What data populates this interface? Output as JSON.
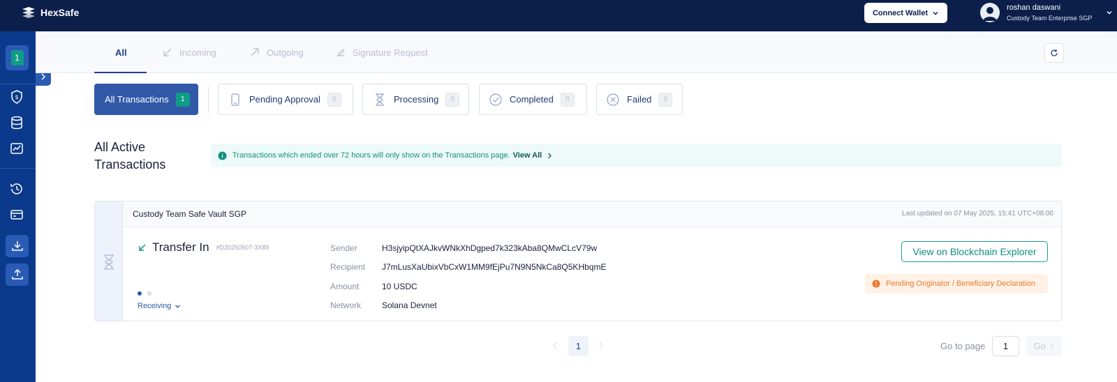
{
  "app": {
    "name": "HexSafe"
  },
  "header": {
    "connect_wallet": "Connect Wallet",
    "user_name": "roshan daswani",
    "user_org": "Custody Team Enterprise SGP"
  },
  "sidebar": {
    "badge": "1",
    "items": [
      "shield-icon",
      "database-icon",
      "chart-icon",
      "history-icon",
      "card-icon",
      "download-icon",
      "upload-icon"
    ]
  },
  "tabs": [
    {
      "label": "All",
      "icon": "",
      "active": true
    },
    {
      "label": "Incoming",
      "icon": "arrow-down-left-icon",
      "active": false
    },
    {
      "label": "Outgoing",
      "icon": "arrow-up-right-icon",
      "active": false
    },
    {
      "label": "Signature Request",
      "icon": "signature-icon",
      "active": false
    }
  ],
  "filters": [
    {
      "label": "All Transactions",
      "count": "1",
      "icon": "",
      "active": true
    },
    {
      "label": "Pending Approval",
      "count": "0",
      "icon": "phone-icon",
      "active": false
    },
    {
      "label": "Processing",
      "count": "0",
      "icon": "hourglass-icon",
      "active": false
    },
    {
      "label": "Completed",
      "count": "0",
      "icon": "check-circle-icon",
      "active": false
    },
    {
      "label": "Failed",
      "count": "0",
      "icon": "x-circle-icon",
      "active": false
    }
  ],
  "section": {
    "title": "All Active Transactions",
    "notice": "Transactions which ended over 72 hours will only show on the Transactions page.",
    "notice_link": "View All"
  },
  "transaction": {
    "vault": "Custody Team Safe Vault SGP",
    "updated": "Last updated on 07 May 2025, 15:41 UTC+08:00",
    "type": "Transfer In",
    "id": "#D20250507-3X89",
    "status": "Receiving",
    "progress_step": 1,
    "progress_total": 2,
    "fields": [
      {
        "label": "Sender",
        "value": "H3sjyipQtXAJkvWNkXhDgped7k323kAba8QMwCLcV79w"
      },
      {
        "label": "Recipient",
        "value": "J7mLusXaUbixVbCxW1MM9fEjPu7N9N5NkCa8Q5KHbqmE"
      },
      {
        "label": "Amount",
        "value": "10 USDC"
      },
      {
        "label": "Network",
        "value": "Solana Devnet"
      }
    ],
    "explorer_button": "View on Blockchain Explorer",
    "pending_badge": "Pending Originator / Beneficiary Declaration"
  },
  "pagination": {
    "current_page": "1",
    "goto_label": "Go to page",
    "goto_value": "1",
    "go_label": "Go"
  },
  "colors": {
    "topbar": "#0b1f4a",
    "sidebar": "#0b3a8c",
    "accent": "#3159a8",
    "teal": "#0e9c86",
    "warning": "#ea7a28"
  }
}
